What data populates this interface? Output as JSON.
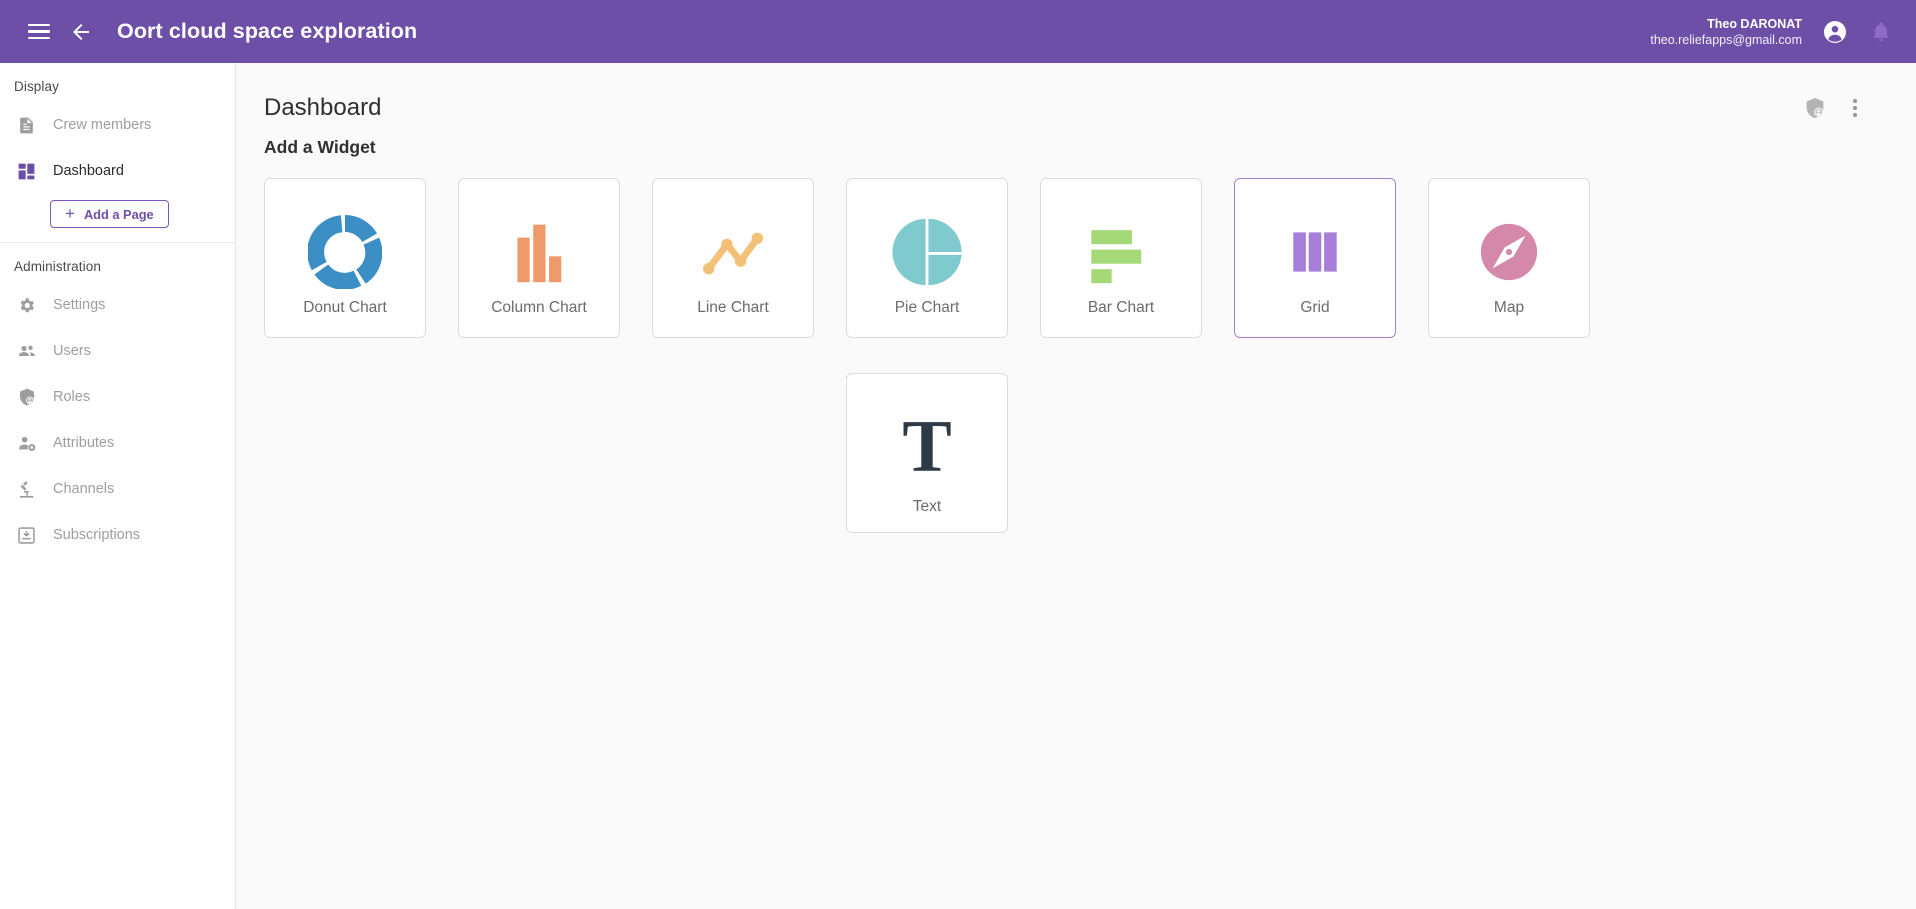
{
  "appbar": {
    "menu_icon": "hamburger-menu-icon",
    "back_icon": "back-arrow-icon",
    "title": "Oort cloud space exploration",
    "user_name": "Theo DARONAT",
    "user_email": "theo.reliefapps@gmail.com",
    "account_icon": "account-circle-icon",
    "notification_icon": "bell-icon",
    "background_color": "#6d4fa8"
  },
  "sidebar": {
    "sections": [
      {
        "label": "Display",
        "items": [
          {
            "label": "Crew members",
            "icon": "document-icon",
            "active": false
          },
          {
            "label": "Dashboard",
            "icon": "dashboard-icon",
            "active": true
          }
        ],
        "action": {
          "label": "Add a Page",
          "icon": "plus-icon"
        }
      },
      {
        "label": "Administration",
        "items": [
          {
            "label": "Settings",
            "icon": "gear-icon",
            "active": false
          },
          {
            "label": "Users",
            "icon": "users-icon",
            "active": false
          },
          {
            "label": "Roles",
            "icon": "shield-person-icon",
            "active": false
          },
          {
            "label": "Attributes",
            "icon": "person-gear-icon",
            "active": false
          },
          {
            "label": "Channels",
            "icon": "microscope-icon",
            "active": false
          },
          {
            "label": "Subscriptions",
            "icon": "inbox-download-icon",
            "active": false
          }
        ]
      }
    ],
    "active_color": "#6d4fa8",
    "inactive_color": "#9e9e9e"
  },
  "main": {
    "page_title": "Dashboard",
    "header_actions": [
      {
        "icon": "shield-person-icon",
        "name": "permissions-button"
      },
      {
        "icon": "more-vert-icon",
        "name": "more-options-button"
      }
    ],
    "section_title": "Add a Widget",
    "widgets": [
      {
        "label": "Donut Chart",
        "icon": "donut-chart-icon",
        "color": "#3b8fc4",
        "highlight": false
      },
      {
        "label": "Column Chart",
        "icon": "column-chart-icon",
        "color": "#ef9a6a",
        "highlight": false
      },
      {
        "label": "Line Chart",
        "icon": "line-chart-icon",
        "color": "#f3c077",
        "highlight": false
      },
      {
        "label": "Pie Chart",
        "icon": "pie-chart-icon",
        "color": "#80c9ce",
        "highlight": false
      },
      {
        "label": "Bar Chart",
        "icon": "bar-chart-icon",
        "color": "#a5d978",
        "highlight": false
      },
      {
        "label": "Grid",
        "icon": "grid-icon",
        "color": "#a87fd8",
        "highlight": true
      },
      {
        "label": "Map",
        "icon": "compass-map-icon",
        "color": "#d489ab",
        "highlight": false
      },
      {
        "label": "Text",
        "icon": "text-t-icon",
        "color": "#2d3a47",
        "highlight": false
      }
    ]
  }
}
